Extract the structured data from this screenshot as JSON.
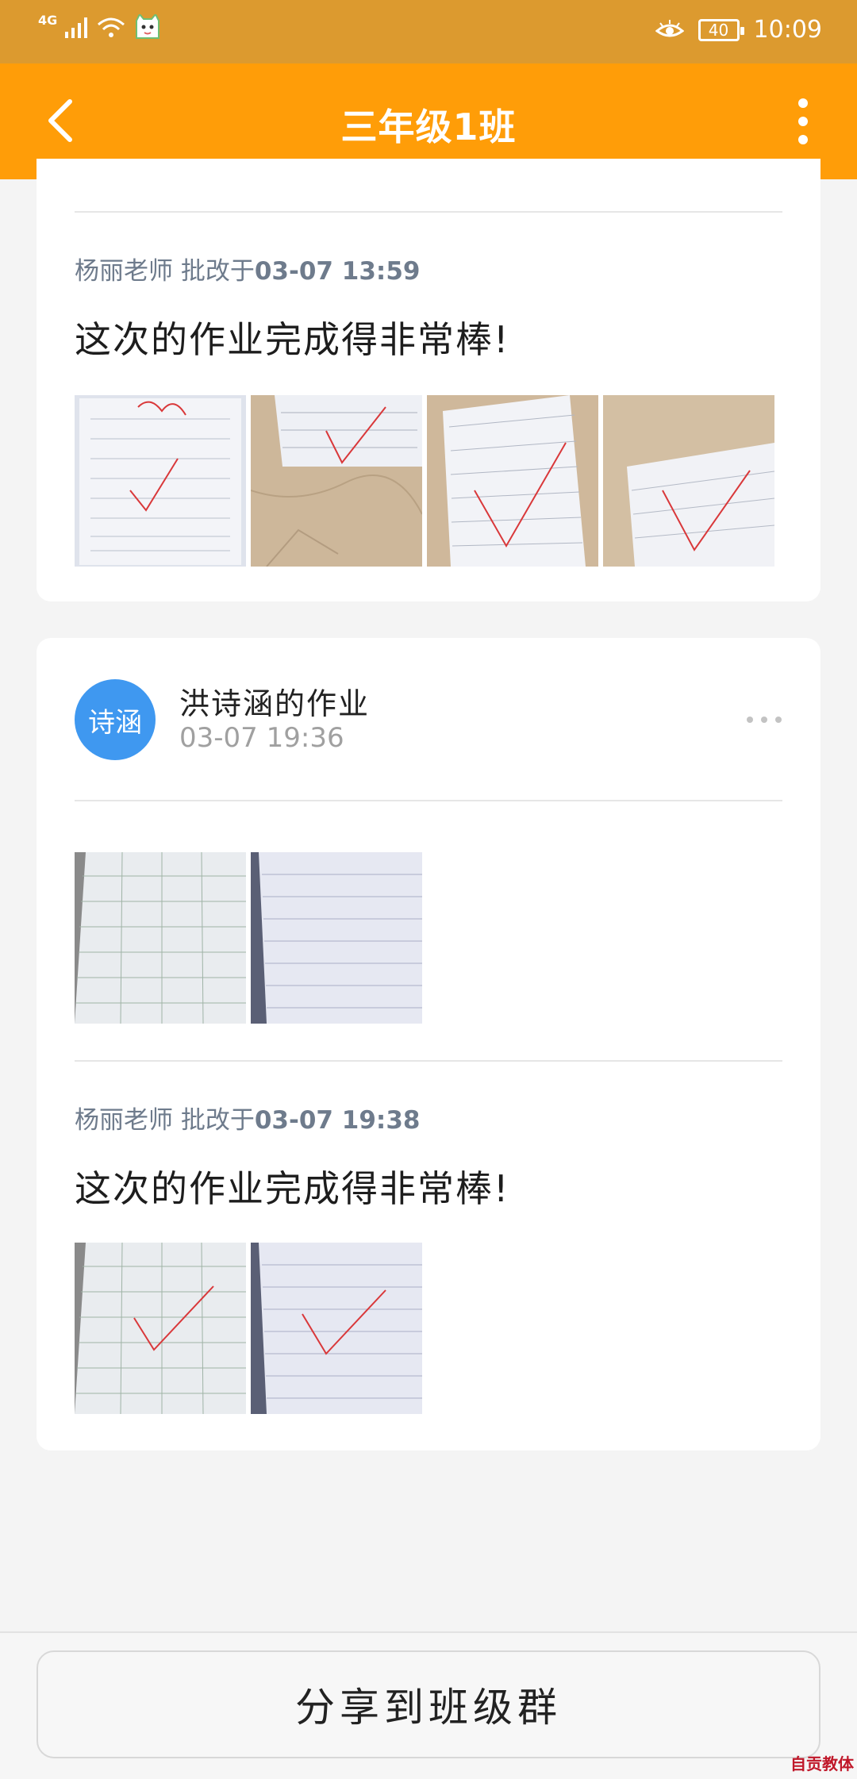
{
  "status_bar": {
    "network": "4G",
    "battery": "40",
    "time": "10:09"
  },
  "app_bar": {
    "title": "三年级1班"
  },
  "card1": {
    "review": {
      "teacher": "杨丽老师",
      "action": "批改于",
      "time": "03-07 13:59"
    },
    "comment": "这次的作业完成得非常棒!"
  },
  "card2": {
    "avatar_text": "诗涵",
    "author": "洪诗涵的作业",
    "date": "03-07 19:36",
    "review": {
      "teacher": "杨丽老师",
      "action": "批改于",
      "time": "03-07 19:38"
    },
    "comment": "这次的作业完成得非常棒!"
  },
  "bottom": {
    "share_label": "分享到班级群"
  },
  "watermark": "自贡教体"
}
